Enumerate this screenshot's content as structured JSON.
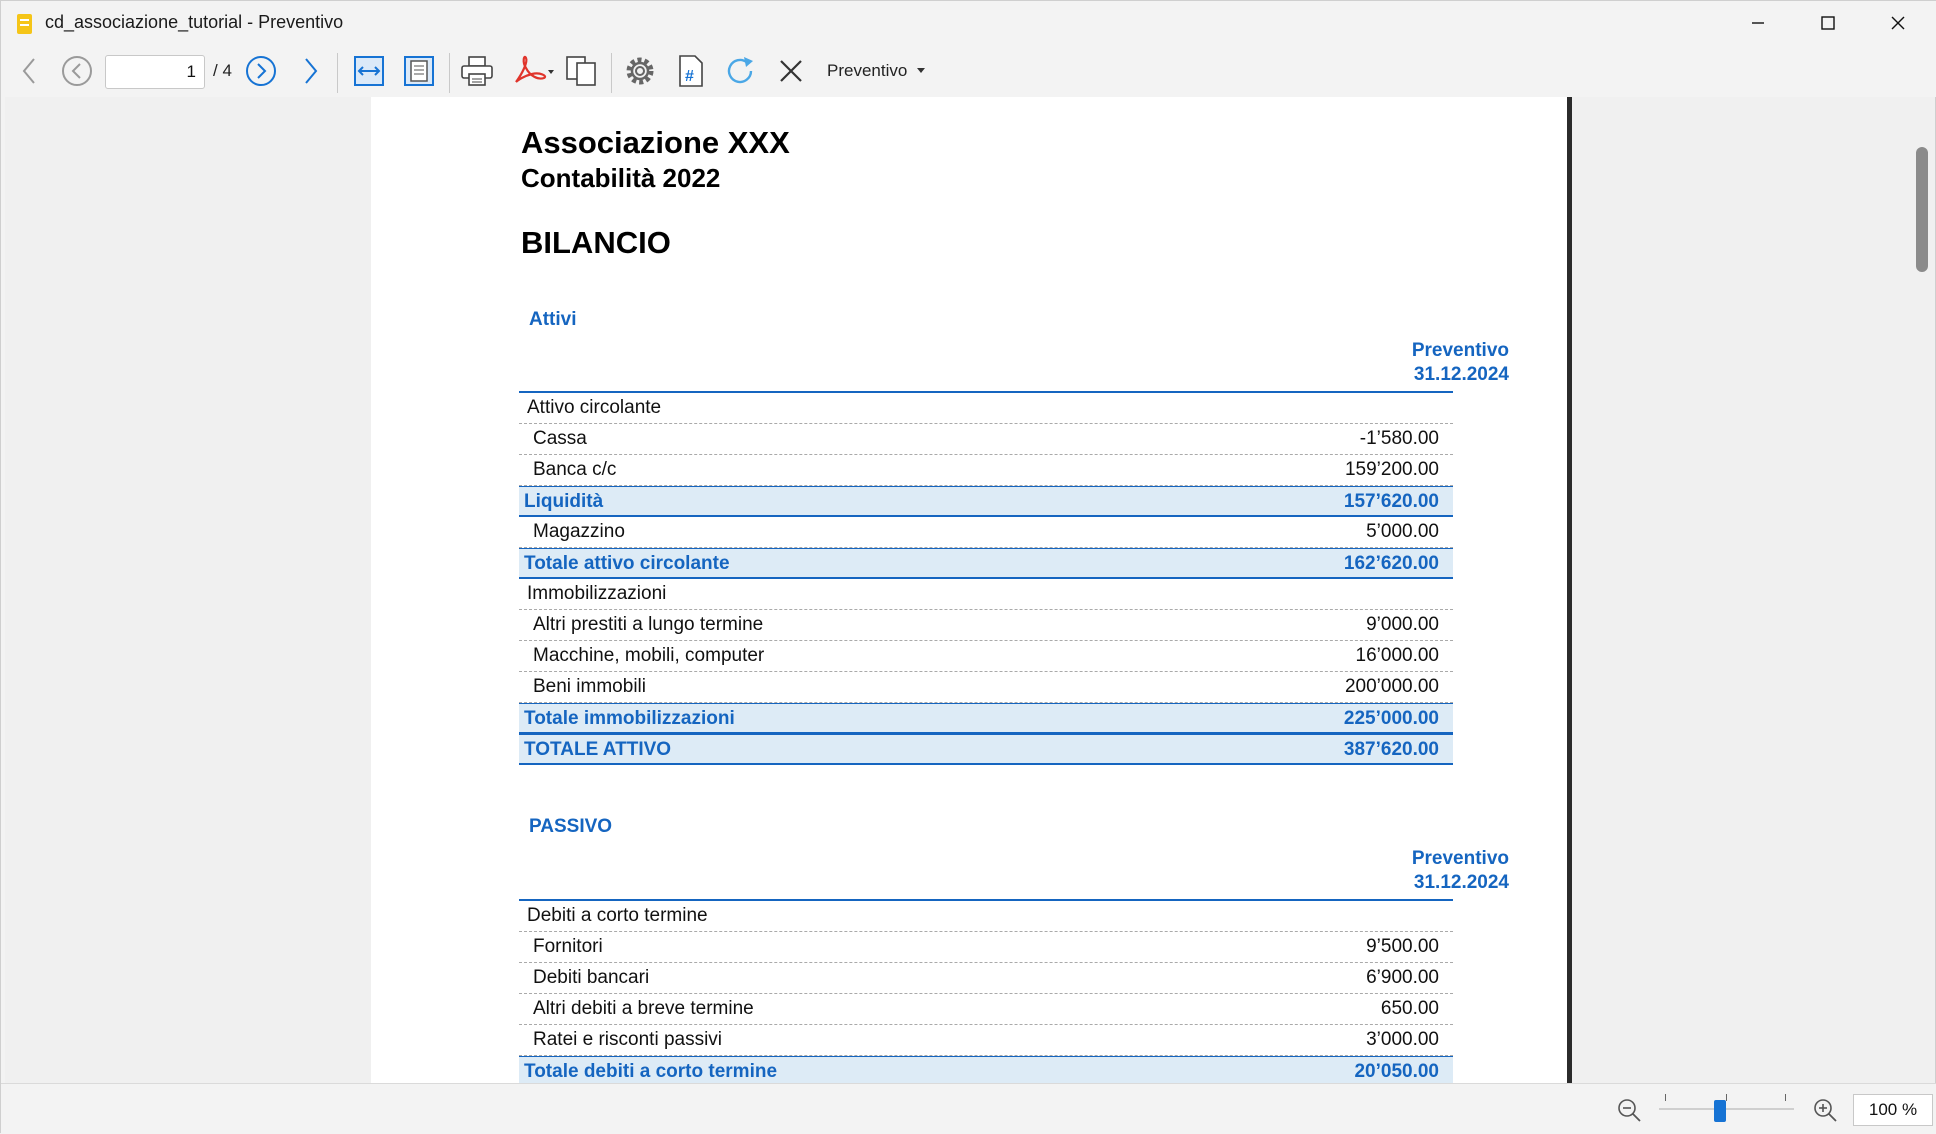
{
  "window": {
    "title": "cd_associazione_tutorial - Preventivo",
    "minimize_icon": "minimize-icon",
    "maximize_icon": "maximize-icon",
    "close_icon": "close-icon"
  },
  "toolbar": {
    "page_current": "1",
    "page_total": "/ 4",
    "view_selector": "Preventivo",
    "icons": [
      "back-arrow-icon",
      "previous-page-icon",
      "next-page-icon",
      "forward-arrow-icon",
      "fit-width-icon",
      "fit-page-icon",
      "print-icon",
      "pdf-icon",
      "copy-icon",
      "settings-icon",
      "page-number-icon",
      "refresh-icon",
      "close-icon"
    ]
  },
  "document": {
    "organization": "Associazione XXX",
    "accounting_year": "Contabilità 2022",
    "report_title": "BILANCIO",
    "assets": {
      "section_title": "Attivi",
      "column_header_line1": "Preventivo",
      "column_header_line2": "31.12.2024",
      "rows": [
        {
          "type": "group",
          "label": "Attivo circolante",
          "value": ""
        },
        {
          "type": "item",
          "label": "Cassa",
          "value": "-1’580.00"
        },
        {
          "type": "item",
          "label": "Banca c/c",
          "value": "159’200.00"
        },
        {
          "type": "total",
          "label": "Liquidità",
          "value": "157’620.00"
        },
        {
          "type": "item",
          "label": "Magazzino",
          "value": "5’000.00"
        },
        {
          "type": "total",
          "label": "Totale attivo circolante",
          "value": "162’620.00"
        },
        {
          "type": "group",
          "label": "Immobilizzazioni",
          "value": ""
        },
        {
          "type": "item",
          "label": "Altri prestiti a lungo termine",
          "value": "9’000.00"
        },
        {
          "type": "item",
          "label": "Macchine, mobili, computer",
          "value": "16’000.00"
        },
        {
          "type": "item",
          "label": "Beni immobili",
          "value": "200’000.00"
        },
        {
          "type": "total",
          "label": "Totale immobilizzazioni",
          "value": "225’000.00"
        },
        {
          "type": "total",
          "label": "TOTALE ATTIVO",
          "value": "387’620.00"
        }
      ]
    },
    "liabilities": {
      "section_title": "PASSIVO",
      "column_header_line1": "Preventivo",
      "column_header_line2": "31.12.2024",
      "rows": [
        {
          "type": "group",
          "label": "Debiti a corto termine",
          "value": ""
        },
        {
          "type": "item",
          "label": "Fornitori",
          "value": "9’500.00"
        },
        {
          "type": "item",
          "label": "Debiti bancari",
          "value": "6’900.00"
        },
        {
          "type": "item",
          "label": "Altri debiti a breve termine",
          "value": "650.00"
        },
        {
          "type": "item",
          "label": "Ratei e risconti passivi",
          "value": "3’000.00"
        },
        {
          "type": "total",
          "label": "Totale debiti a corto termine",
          "value": "20’050.00"
        }
      ]
    }
  },
  "statusbar": {
    "zoom_level": "100 %",
    "zoom_fraction": 0.45,
    "zoom_out_icon": "zoom-out-icon",
    "zoom_in_icon": "zoom-in-icon"
  },
  "colors": {
    "accent_blue": "#1565c0",
    "total_row_bg": "#ddebf6"
  }
}
